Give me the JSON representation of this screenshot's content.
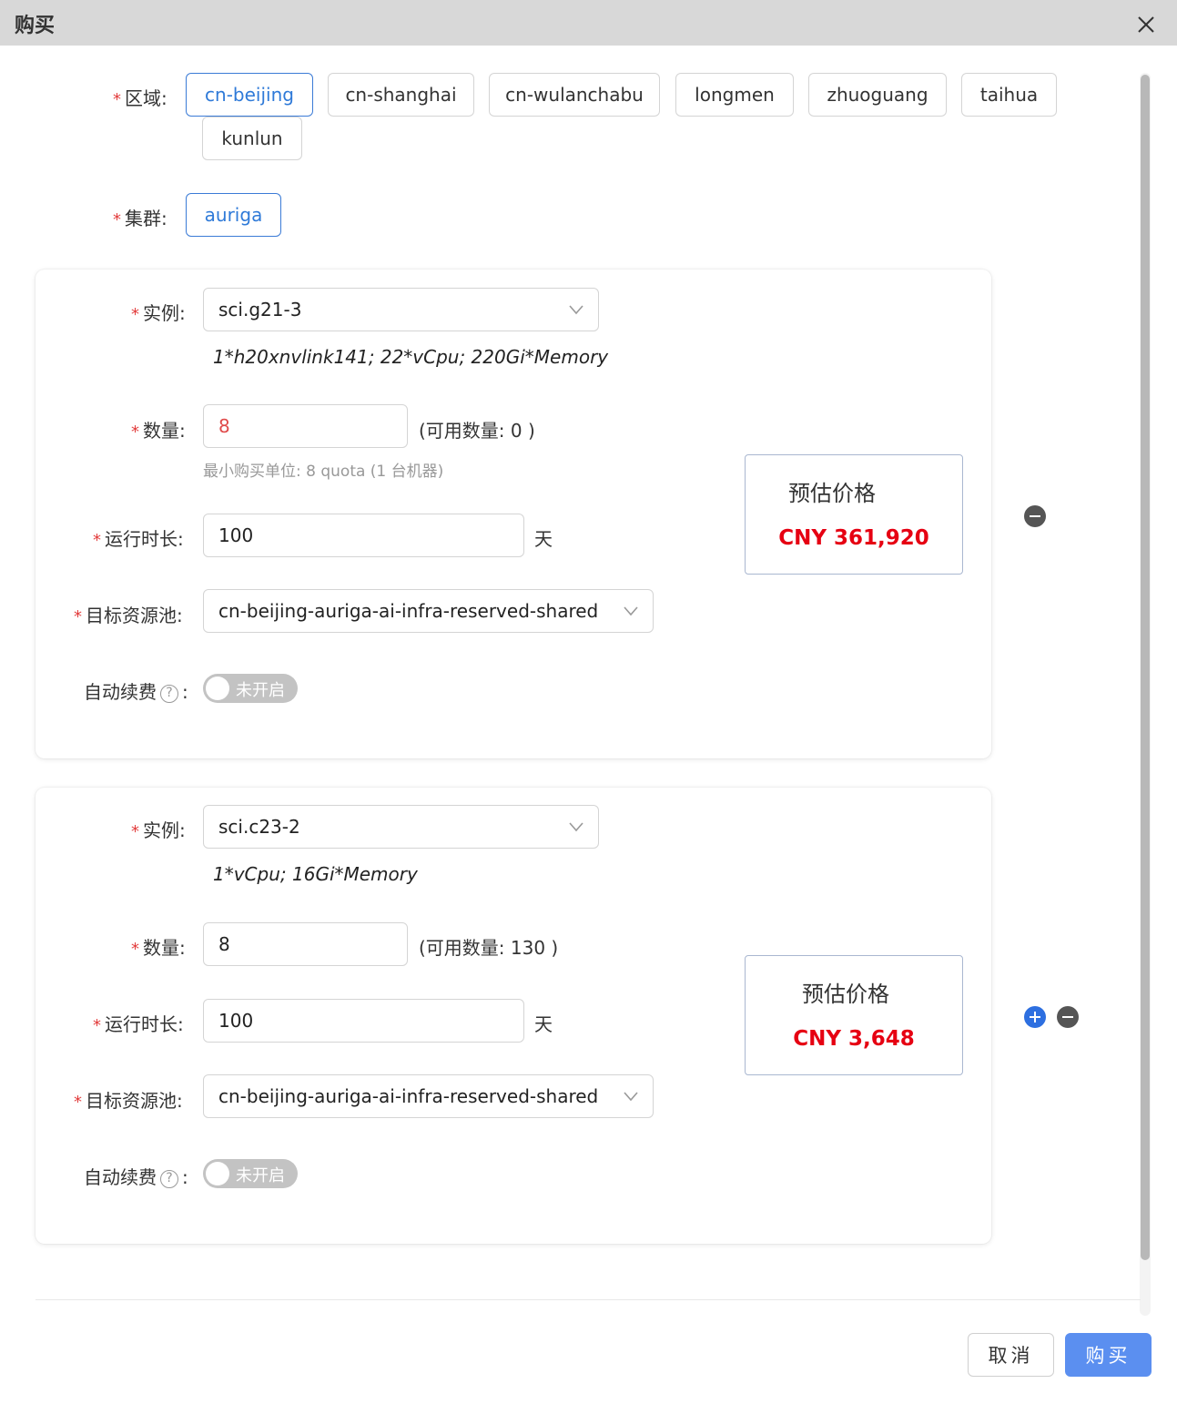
{
  "dialog": {
    "title": "购买"
  },
  "region": {
    "label": "区域",
    "options": [
      "cn-beijing",
      "cn-shanghai",
      "cn-wulanchabu",
      "longmen",
      "zhuoguang",
      "taihua",
      "kunlun"
    ],
    "selected": "cn-beijing"
  },
  "cluster": {
    "label": "集群",
    "options": [
      "auriga"
    ],
    "selected": "auriga"
  },
  "labels": {
    "instance": "实例",
    "quantity": "数量",
    "duration": "运行时长",
    "pool": "目标资源池",
    "autorenew": "自动续费",
    "days_unit": "天",
    "price_title": "预估价格",
    "toggle_off": "未开启",
    "colon": ":"
  },
  "items": [
    {
      "instance": "sci.g21-3",
      "specs": "1*h20xnvlink141; 22*vCpu; 220Gi*Memory",
      "quantity": "8",
      "available": "(可用数量: 0  )",
      "min_unit_hint": "最小购买单位: 8 quota (1 台机器)",
      "duration": "100",
      "pool": "cn-beijing-auriga-ai-infra-reserved-shared",
      "autorenew": false,
      "price": "CNY 361,920"
    },
    {
      "instance": "sci.c23-2",
      "specs": "1*vCpu; 16Gi*Memory",
      "quantity": "8",
      "available": "(可用数量: 130 )",
      "duration": "100",
      "pool": "cn-beijing-auriga-ai-infra-reserved-shared",
      "autorenew": false,
      "price": "CNY 3,648"
    }
  ],
  "footer": {
    "cancel": "取消",
    "buy": "购买"
  },
  "colors": {
    "primary": "#5b8ff0",
    "price_red": "#e60012",
    "required_red": "#e23b3b",
    "active_chip": "#2f7ad8"
  }
}
